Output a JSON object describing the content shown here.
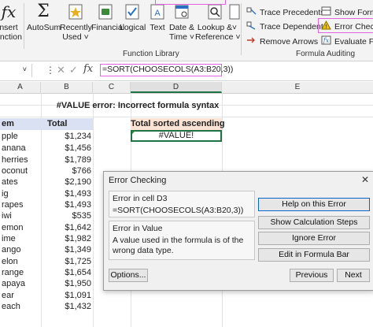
{
  "ribbon": {
    "insert_function": {
      "line1": "nsert",
      "line2": "unction"
    },
    "autosum": "AutoSum",
    "recently_used": {
      "line1": "Recently",
      "line2": "Used ˅"
    },
    "financial": "Financial",
    "logical": "Logical",
    "text": "Text",
    "date_time": {
      "line1": "Date &",
      "line2": "Time ˅"
    },
    "lookup_reference": {
      "line1": "Lookup &",
      "line2": "Reference ˅"
    },
    "more": "˅",
    "function_library_label": "Function Library",
    "trace_precedents": "Trace Precedents",
    "trace_dependents": "Trace Dependents",
    "remove_arrows": "Remove Arrows",
    "show_formulas": "Show Formula",
    "error_checking": "Error Checking",
    "evaluate_formula": "Evaluate Form",
    "formula_auditing_label": "Formula Auditing"
  },
  "formula_bar": {
    "fx": "fx",
    "formula": "=SORT(CHOOSECOLS(A3:B20,3))"
  },
  "columns": [
    "A",
    "B",
    "C",
    "D",
    "E"
  ],
  "sheet": {
    "title": "#VALUE error: Incorrect formula syntax",
    "header_item": "em",
    "header_total": "Total",
    "header_sorted": "Total sorted ascending",
    "result": "#VALUE!",
    "rows": [
      {
        "item": "pple",
        "total": "$1,234"
      },
      {
        "item": "anana",
        "total": "$1,456"
      },
      {
        "item": "herries",
        "total": "$1,789"
      },
      {
        "item": "oconut",
        "total": "$766"
      },
      {
        "item": "ates",
        "total": "$2,190"
      },
      {
        "item": "ig",
        "total": "$1,493"
      },
      {
        "item": "rapes",
        "total": "$1,493"
      },
      {
        "item": "iwi",
        "total": "$535"
      },
      {
        "item": "emon",
        "total": "$1,642"
      },
      {
        "item": "ime",
        "total": "$1,982"
      },
      {
        "item": "ango",
        "total": "$1,349"
      },
      {
        "item": "elon",
        "total": "$1,725"
      },
      {
        "item": "range",
        "total": "$1,654"
      },
      {
        "item": "apaya",
        "total": "$1,950"
      },
      {
        "item": "ear",
        "total": "$1,091"
      },
      {
        "item": "each",
        "total": "$1,432"
      }
    ]
  },
  "dialog": {
    "title": "Error Checking",
    "close": "✕",
    "error_in_cell": "Error in cell D3",
    "formula": "=SORT(CHOOSECOLS(A3:B20,3))",
    "error_in_value": "Error in Value",
    "description": "A value used in the formula is of the wrong data type.",
    "help_button": "Help on this Error",
    "show_steps_button": "Show Calculation Steps",
    "ignore_button": "Ignore Error",
    "edit_button": "Edit in Formula Bar",
    "options_button": "Options...",
    "previous_button": "Previous",
    "next_button": "Next"
  },
  "colors": {
    "accent_pink": "#e064e0",
    "header_blue": "#d9e1f2",
    "header_peach": "#fbe4d5",
    "selected_green": "#217346"
  }
}
